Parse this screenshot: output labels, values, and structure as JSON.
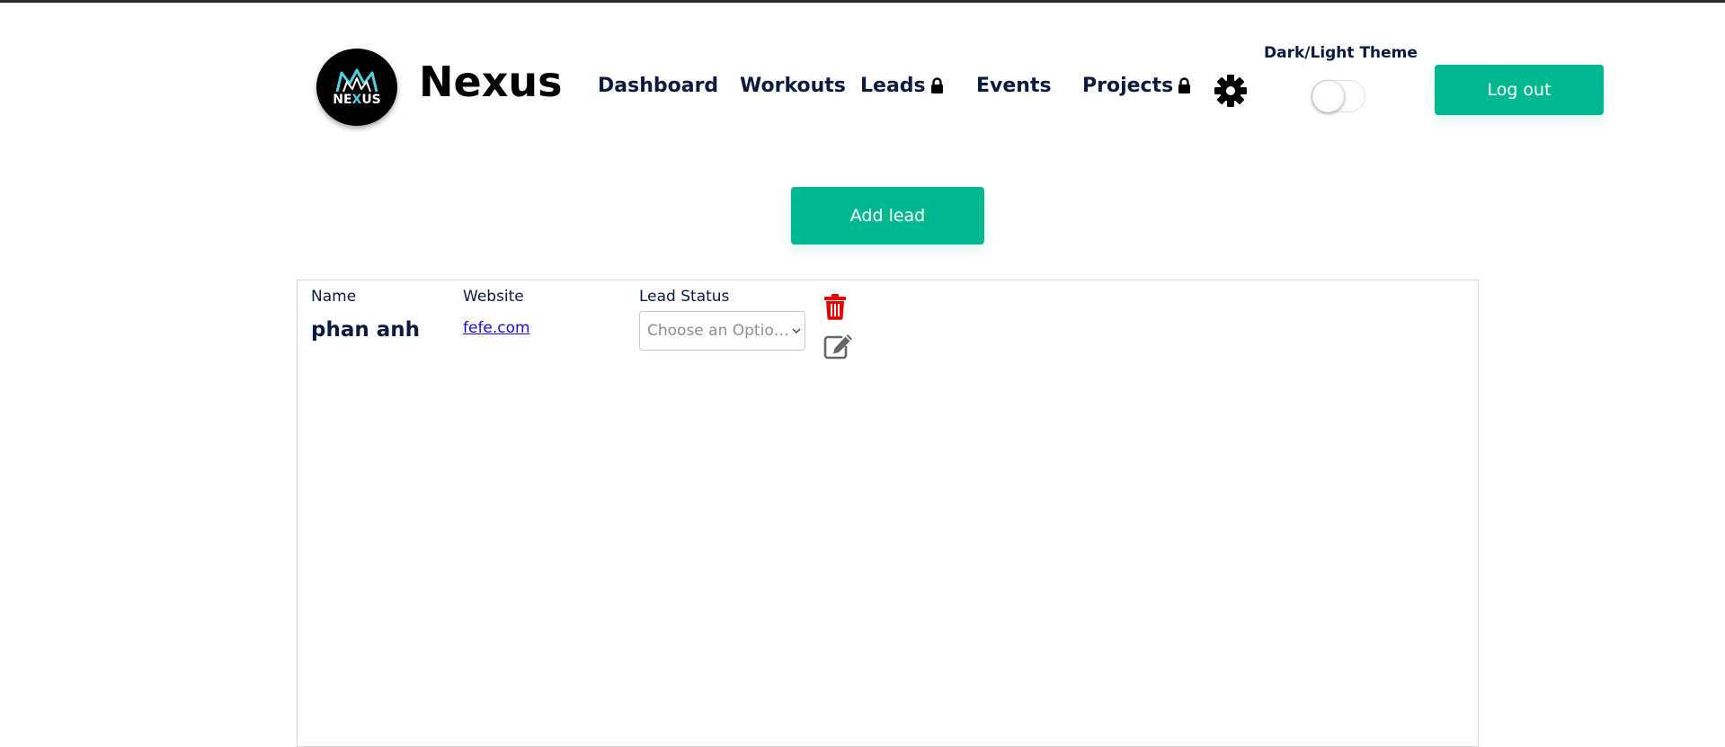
{
  "brand": {
    "logo_text_a": "NE",
    "logo_text_b": "X",
    "logo_text_c": "US",
    "name": "Nexus"
  },
  "nav": {
    "items": [
      {
        "label": "Dashboard",
        "locked": false
      },
      {
        "label": "Workouts",
        "locked": false
      },
      {
        "label": "Leads",
        "locked": true
      },
      {
        "label": "Events",
        "locked": false
      },
      {
        "label": "Projects",
        "locked": true
      }
    ]
  },
  "theme": {
    "label": "Dark/Light Theme",
    "dark_enabled": false
  },
  "header": {
    "logout_label": "Log out"
  },
  "main": {
    "add_lead_label": "Add lead",
    "columns": {
      "name": "Name",
      "website": "Website",
      "status": "Lead Status"
    },
    "leads": [
      {
        "name": "phan anh",
        "website": "fefe.com",
        "status_placeholder": "Choose an Option..."
      }
    ]
  },
  "colors": {
    "accent": "#00b88f",
    "nav_text": "#0c1a3d",
    "danger": "#e60000",
    "link": "#1a0dcc"
  },
  "icons": {
    "settings": "gear-icon",
    "lock": "lock-icon",
    "delete": "trash-icon",
    "edit": "edit-icon",
    "dropdown": "chevron-down-icon"
  }
}
